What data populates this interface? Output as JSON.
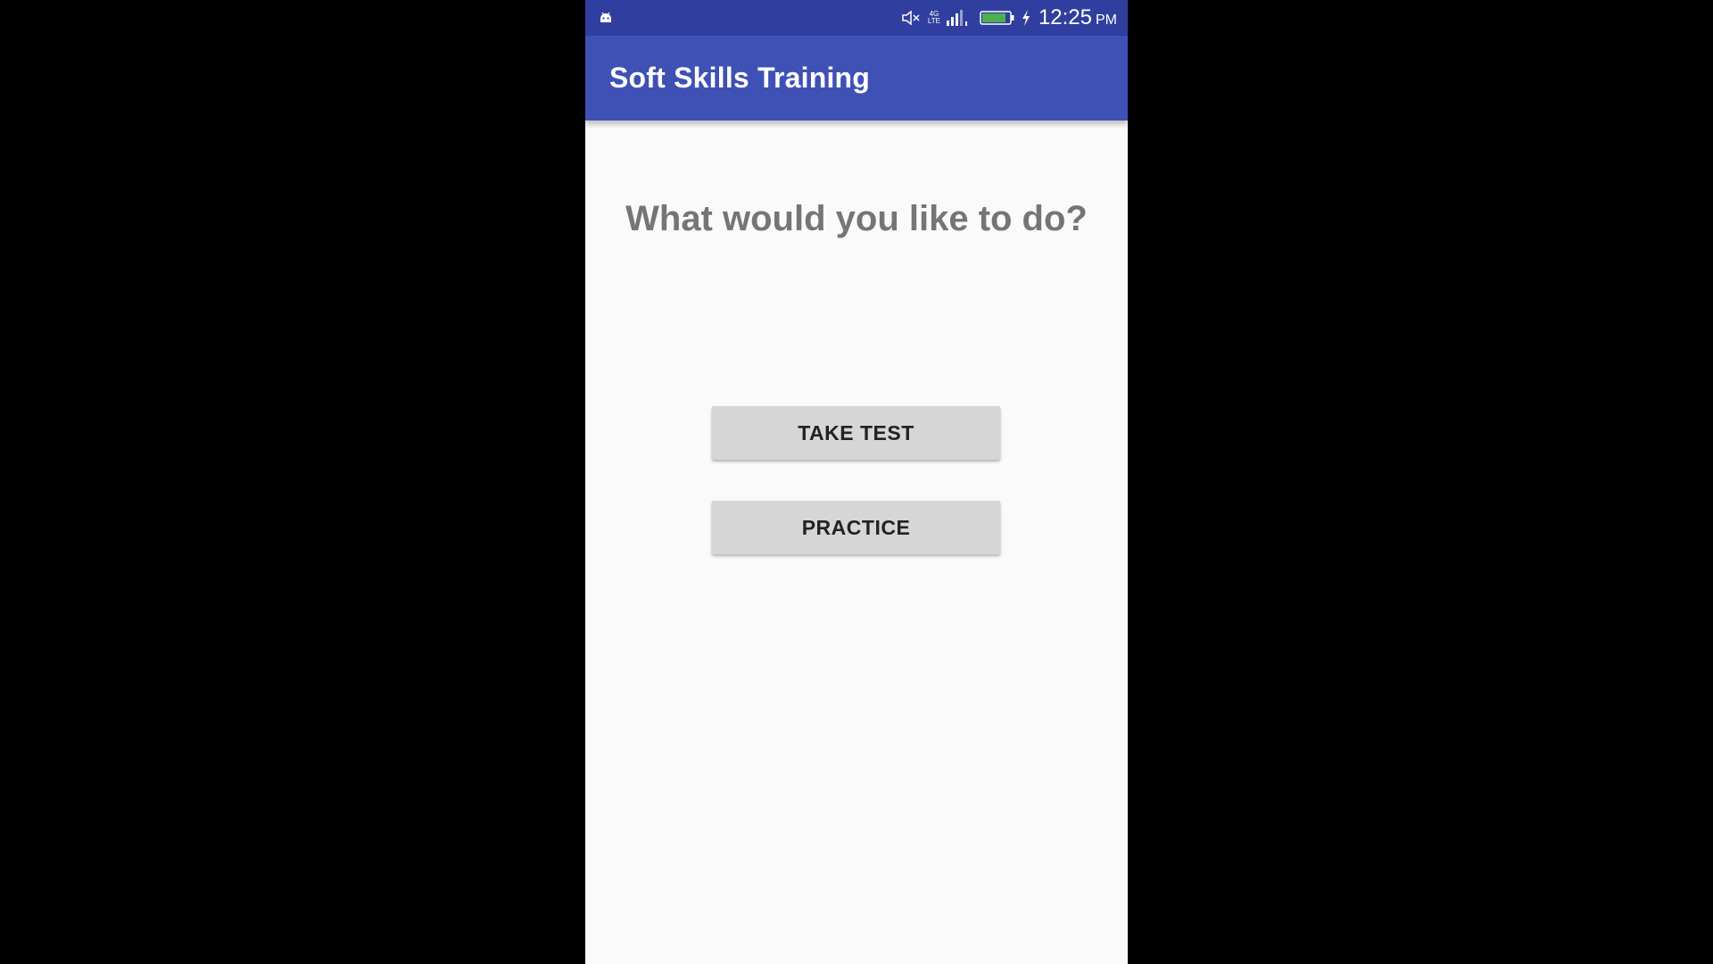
{
  "status_bar": {
    "time": "12:25",
    "ampm": "PM",
    "network_top": "4G",
    "network_bottom": "LTE",
    "icons": [
      "android-icon",
      "mute-icon",
      "signal-icon",
      "battery-icon",
      "charging-icon"
    ],
    "background": "#303f9f"
  },
  "app_bar": {
    "title": "Soft Skills Training",
    "background": "#3f51b5"
  },
  "main": {
    "prompt": "What would you like to do?",
    "buttons": {
      "take_test": "TAKE TEST",
      "practice": "PRACTICE"
    }
  },
  "colors": {
    "page_background": "#fafafa",
    "button_background": "#d6d6d6",
    "prompt_text": "#757575",
    "battery_fill": "#4caf50"
  }
}
